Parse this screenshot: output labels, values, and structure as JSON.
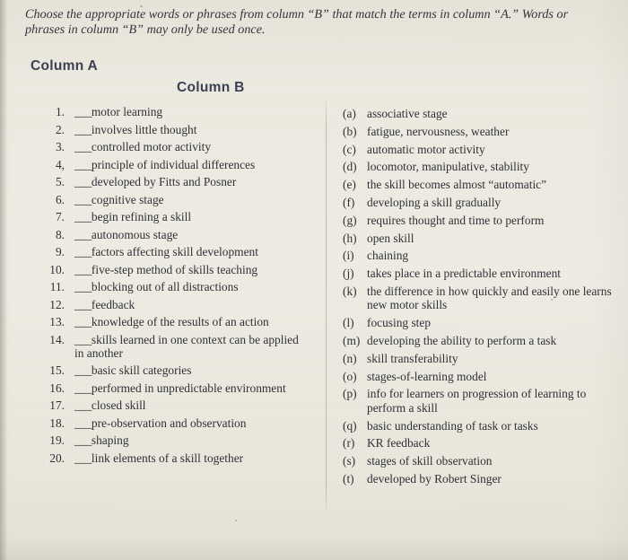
{
  "document": {
    "instructions": "Choose the appropriate words or phrases from column “B” that match the terms in column “A.” Words or phrases in column “B” may only be used once.",
    "column_a_heading": "Column A",
    "column_b_heading": "Column B",
    "blank": "___"
  },
  "column_a": [
    {
      "number": "1.",
      "text": "motor learning"
    },
    {
      "number": "2.",
      "text": "involves little thought"
    },
    {
      "number": "3.",
      "text": "controlled motor activity"
    },
    {
      "number": "4,",
      "text": "principle of individual differences"
    },
    {
      "number": "5.",
      "text": "developed by Fitts and Posner"
    },
    {
      "number": "6.",
      "text": "cognitive stage"
    },
    {
      "number": "7.",
      "text": "begin refining a skill"
    },
    {
      "number": "8.",
      "text": "autonomous stage"
    },
    {
      "number": "9.",
      "text": "factors affecting skill development"
    },
    {
      "number": "10.",
      "text": "five-step method of skills teaching"
    },
    {
      "number": "11.",
      "text": "blocking out of all distractions"
    },
    {
      "number": "12.",
      "text": "feedback"
    },
    {
      "number": "13.",
      "text": "knowledge of the results of an action"
    },
    {
      "number": "14.",
      "text": "skills learned in one context can be applied in another"
    },
    {
      "number": "15.",
      "text": "basic skill categories"
    },
    {
      "number": "16.",
      "text": "performed in unpredictable environment"
    },
    {
      "number": "17.",
      "text": "closed skill"
    },
    {
      "number": "18.",
      "text": "pre-observation and observation"
    },
    {
      "number": "19.",
      "text": "shaping"
    },
    {
      "number": "20.",
      "text": "link elements of a skill together"
    }
  ],
  "column_b": [
    {
      "label": "(a)",
      "text": "associative stage"
    },
    {
      "label": "(b)",
      "text": "fatigue, nervousness, weather"
    },
    {
      "label": "(c)",
      "text": "automatic motor activity"
    },
    {
      "label": "(d)",
      "text": "locomotor, manipulative, stability"
    },
    {
      "label": "(e)",
      "text": "the skill becomes almost “automatic”"
    },
    {
      "label": "(f)",
      "text": "developing a skill gradually"
    },
    {
      "label": "(g)",
      "text": "requires thought and time to perform"
    },
    {
      "label": "(h)",
      "text": "open skill"
    },
    {
      "label": "(i)",
      "text": "chaining"
    },
    {
      "label": "(j)",
      "text": "takes place in a predictable environment"
    },
    {
      "label": "(k)",
      "text": "the difference in how quickly and easily one learns new motor skills"
    },
    {
      "label": "(l)",
      "text": "focusing step"
    },
    {
      "label": "(m)",
      "text": "developing the ability to perform a task"
    },
    {
      "label": "(n)",
      "text": "skill transferability"
    },
    {
      "label": "(o)",
      "text": "stages-of-learning model"
    },
    {
      "label": "(p)",
      "text": "info for learners on progression of learning to perform a skill"
    },
    {
      "label": "(q)",
      "text": "basic understanding of task or tasks"
    },
    {
      "label": "(r)",
      "text": "KR feedback"
    },
    {
      "label": "(s)",
      "text": "stages of skill observation"
    },
    {
      "label": "(t)",
      "text": "developed by Robert Singer"
    }
  ]
}
